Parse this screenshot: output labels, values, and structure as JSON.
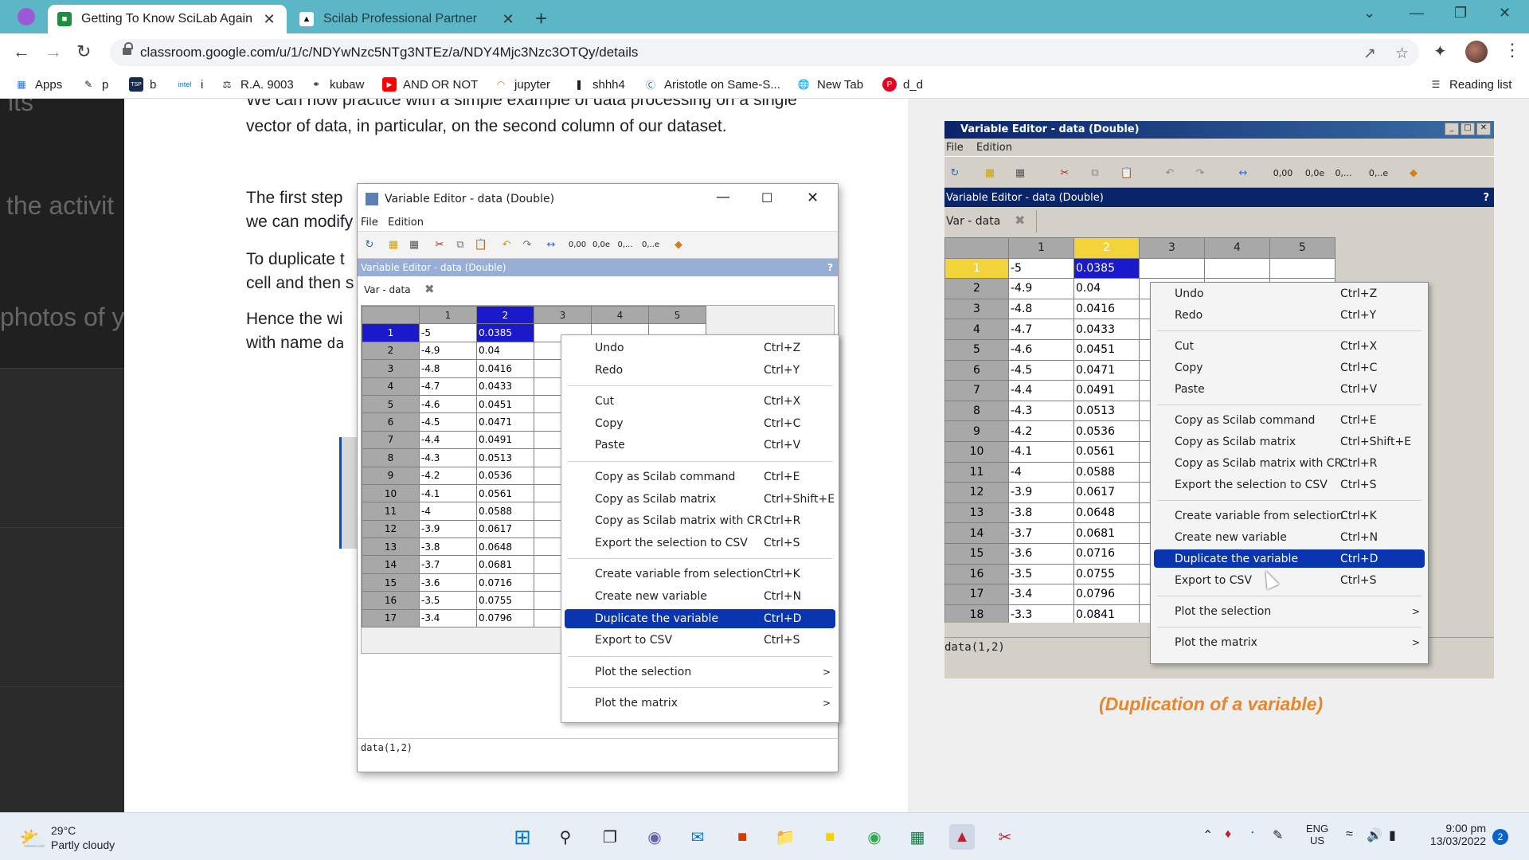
{
  "browser": {
    "tabs": [
      {
        "title": "Getting To Know SciLab Again",
        "icon": "google-classroom-icon",
        "active": true
      },
      {
        "title": "Scilab Professional Partner",
        "icon": "scilab-icon",
        "active": false
      }
    ],
    "url": "classroom.google.com/u/1/c/NDYwNzc5NTg3NTEz/a/NDY4Mjc3Nzc3OTQy/details",
    "bookmarks": [
      {
        "label": "Apps",
        "icon": "apps-grid-icon"
      },
      {
        "label": "p",
        "icon": "pencil-icon"
      },
      {
        "label": "b",
        "icon": "tsp-icon"
      },
      {
        "label": "i",
        "icon": "intel-icon"
      },
      {
        "label": "R.A. 9003",
        "icon": "scale-icon"
      },
      {
        "label": "kubaw",
        "icon": "link-icon"
      },
      {
        "label": "AND OR NOT",
        "icon": "youtube-icon"
      },
      {
        "label": "jupyter",
        "icon": "jupyter-icon"
      },
      {
        "label": "shhh4",
        "icon": "bookmark-icon"
      },
      {
        "label": "Aristotle on Same-S...",
        "icon": "wordpress-icon"
      },
      {
        "label": "New Tab",
        "icon": "globe-icon"
      },
      {
        "label": "d_d",
        "icon": "pinterest-icon"
      }
    ],
    "reading_list": "Reading list"
  },
  "doc": {
    "left_bg": [
      "its",
      "the activit",
      "photos of y"
    ],
    "line1": "We can now practice with a simple example of data processing on a single",
    "line2": "vector of data, in particular, on the second column of our dataset.",
    "line3": "The first step",
    "line4": "we can modify",
    "line5": "To duplicate t",
    "line6": "cell and then s",
    "line7": "Hence the wi",
    "line8a": "with name ",
    "line8b": "da",
    "caption": "(Duplication of a variable)"
  },
  "editor_left": {
    "title": "Variable Editor - data  (Double)",
    "menu": [
      "File",
      "Edition"
    ],
    "toolbar_labels": [
      "0,00",
      "0,0e",
      "0,...",
      "0,..e"
    ],
    "subtitle": "Variable Editor - data  (Double)",
    "help": "?",
    "var_tab": "Var - data",
    "columns": [
      "1",
      "2",
      "3",
      "4",
      "5"
    ],
    "rows": [
      "1",
      "2",
      "3",
      "4",
      "5",
      "6",
      "7",
      "8",
      "9",
      "10",
      "11",
      "12",
      "13",
      "14",
      "15",
      "16",
      "17"
    ],
    "col1": [
      "-5",
      "-4.9",
      "-4.8",
      "-4.7",
      "-4.6",
      "-4.5",
      "-4.4",
      "-4.3",
      "-4.2",
      "-4.1",
      "-4",
      "-3.9",
      "-3.8",
      "-3.7",
      "-3.6",
      "-3.5",
      "-3.4"
    ],
    "col2": [
      "0.0385",
      "0.04",
      "0.0416",
      "0.0433",
      "0.0451",
      "0.0471",
      "0.0491",
      "0.0513",
      "0.0536",
      "0.0561",
      "0.0588",
      "0.0617",
      "0.0648",
      "0.0681",
      "0.0716",
      "0.0755",
      "0.0796"
    ],
    "status": "data(1,2)"
  },
  "menu_left": {
    "items": [
      {
        "label": "Undo",
        "shortcut": "Ctrl+Z"
      },
      {
        "label": "Redo",
        "shortcut": "Ctrl+Y"
      },
      {
        "label": "Cut",
        "shortcut": "Ctrl+X"
      },
      {
        "label": "Copy",
        "shortcut": "Ctrl+C"
      },
      {
        "label": "Paste",
        "shortcut": "Ctrl+V"
      },
      {
        "label": "Copy as Scilab command",
        "shortcut": "Ctrl+E"
      },
      {
        "label": "Copy as Scilab matrix",
        "shortcut": "Ctrl+Shift+E"
      },
      {
        "label": "Copy as Scilab matrix with CR",
        "shortcut": "Ctrl+R"
      },
      {
        "label": "Export the selection to CSV",
        "shortcut": "Ctrl+S"
      },
      {
        "label": "Create variable from selection",
        "shortcut": "Ctrl+K"
      },
      {
        "label": "Create new variable",
        "shortcut": "Ctrl+N"
      },
      {
        "label": "Duplicate the variable",
        "shortcut": "Ctrl+D"
      },
      {
        "label": "Export to CSV",
        "shortcut": "Ctrl+S"
      },
      {
        "label": "Plot the selection",
        "shortcut": ">"
      },
      {
        "label": "Plot the matrix",
        "shortcut": ">"
      }
    ]
  },
  "editor_right": {
    "title": "Variable Editor - data  (Double)",
    "menu": [
      "File",
      "Edition"
    ],
    "toolbar_labels": [
      "0,00",
      "0,0e",
      "0,...",
      "0,..e"
    ],
    "subtitle": "Variable Editor - data  (Double)",
    "help": "?",
    "var_tab": "Var - data",
    "columns": [
      "1",
      "2",
      "3",
      "4",
      "5"
    ],
    "rows": [
      "1",
      "2",
      "3",
      "4",
      "5",
      "6",
      "7",
      "8",
      "9",
      "10",
      "11",
      "12",
      "13",
      "14",
      "15",
      "16",
      "17",
      "18"
    ],
    "col1": [
      "-5",
      "-4.9",
      "-4.8",
      "-4.7",
      "-4.6",
      "-4.5",
      "-4.4",
      "-4.3",
      "-4.2",
      "-4.1",
      "-4",
      "-3.9",
      "-3.8",
      "-3.7",
      "-3.6",
      "-3.5",
      "-3.4",
      "-3.3"
    ],
    "col2": [
      "0.0385",
      "0.04",
      "0.0416",
      "0.0433",
      "0.0451",
      "0.0471",
      "0.0491",
      "0.0513",
      "0.0536",
      "0.0561",
      "0.0588",
      "0.0617",
      "0.0648",
      "0.0681",
      "0.0716",
      "0.0755",
      "0.0796",
      "0.0841"
    ],
    "status": "data(1,2)"
  },
  "menu_right": {
    "items": [
      {
        "label": "Undo",
        "shortcut": "Ctrl+Z"
      },
      {
        "label": "Redo",
        "shortcut": "Ctrl+Y"
      },
      {
        "label": "Cut",
        "shortcut": "Ctrl+X"
      },
      {
        "label": "Copy",
        "shortcut": "Ctrl+C"
      },
      {
        "label": "Paste",
        "shortcut": "Ctrl+V"
      },
      {
        "label": "Copy as Scilab command",
        "shortcut": "Ctrl+E"
      },
      {
        "label": "Copy as Scilab matrix",
        "shortcut": "Ctrl+Shift+E"
      },
      {
        "label": "Copy as Scilab matrix with CR",
        "shortcut": "Ctrl+R"
      },
      {
        "label": "Export the selection to CSV",
        "shortcut": "Ctrl+S"
      },
      {
        "label": "Create variable from selection",
        "shortcut": "Ctrl+K"
      },
      {
        "label": "Create new variable",
        "shortcut": "Ctrl+N"
      },
      {
        "label": "Duplicate the variable",
        "shortcut": "Ctrl+D"
      },
      {
        "label": "Export to CSV",
        "shortcut": "Ctrl+S"
      },
      {
        "label": "Plot the selection",
        "shortcut": ">"
      },
      {
        "label": "Plot the matrix",
        "shortcut": ">"
      }
    ]
  },
  "taskbar": {
    "weather_temp": "29°C",
    "weather_desc": "Partly cloudy",
    "lang1": "ENG",
    "lang2": "US",
    "time": "9:00 pm",
    "date": "13/03/2022",
    "notif": "2"
  },
  "colors": {
    "accent": "#5cb6c6",
    "selection": "#0a35b0",
    "caption": "#e8862a"
  }
}
